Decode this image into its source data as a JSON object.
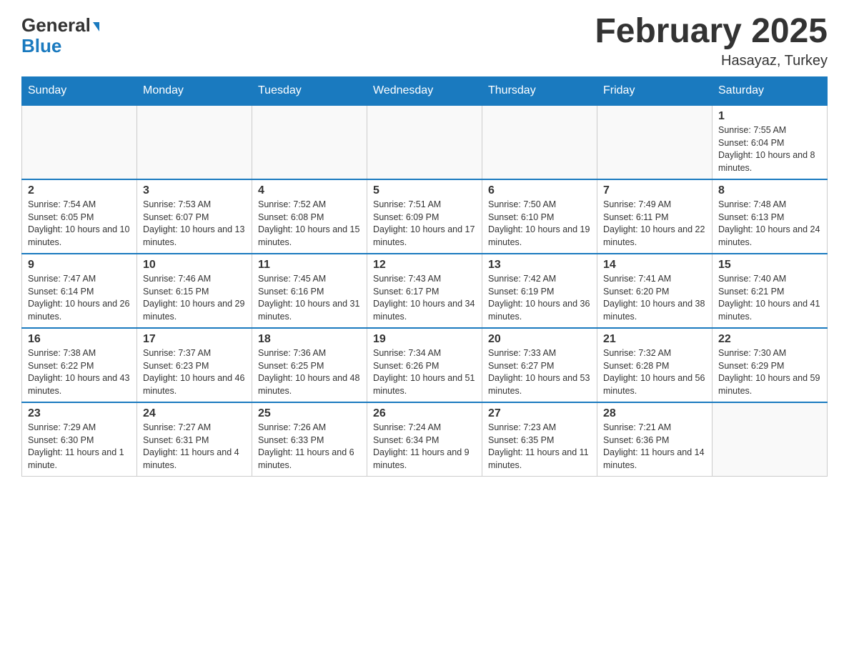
{
  "header": {
    "logo_general": "General",
    "logo_blue": "Blue",
    "month_title": "February 2025",
    "location": "Hasayaz, Turkey"
  },
  "days_of_week": [
    "Sunday",
    "Monday",
    "Tuesday",
    "Wednesday",
    "Thursday",
    "Friday",
    "Saturday"
  ],
  "weeks": [
    {
      "cells": [
        {
          "day": "",
          "empty": true
        },
        {
          "day": "",
          "empty": true
        },
        {
          "day": "",
          "empty": true
        },
        {
          "day": "",
          "empty": true
        },
        {
          "day": "",
          "empty": true
        },
        {
          "day": "",
          "empty": true
        },
        {
          "day": "1",
          "sunrise": "7:55 AM",
          "sunset": "6:04 PM",
          "daylight": "10 hours and 8 minutes."
        }
      ]
    },
    {
      "cells": [
        {
          "day": "2",
          "sunrise": "7:54 AM",
          "sunset": "6:05 PM",
          "daylight": "10 hours and 10 minutes."
        },
        {
          "day": "3",
          "sunrise": "7:53 AM",
          "sunset": "6:07 PM",
          "daylight": "10 hours and 13 minutes."
        },
        {
          "day": "4",
          "sunrise": "7:52 AM",
          "sunset": "6:08 PM",
          "daylight": "10 hours and 15 minutes."
        },
        {
          "day": "5",
          "sunrise": "7:51 AM",
          "sunset": "6:09 PM",
          "daylight": "10 hours and 17 minutes."
        },
        {
          "day": "6",
          "sunrise": "7:50 AM",
          "sunset": "6:10 PM",
          "daylight": "10 hours and 19 minutes."
        },
        {
          "day": "7",
          "sunrise": "7:49 AM",
          "sunset": "6:11 PM",
          "daylight": "10 hours and 22 minutes."
        },
        {
          "day": "8",
          "sunrise": "7:48 AM",
          "sunset": "6:13 PM",
          "daylight": "10 hours and 24 minutes."
        }
      ]
    },
    {
      "cells": [
        {
          "day": "9",
          "sunrise": "7:47 AM",
          "sunset": "6:14 PM",
          "daylight": "10 hours and 26 minutes."
        },
        {
          "day": "10",
          "sunrise": "7:46 AM",
          "sunset": "6:15 PM",
          "daylight": "10 hours and 29 minutes."
        },
        {
          "day": "11",
          "sunrise": "7:45 AM",
          "sunset": "6:16 PM",
          "daylight": "10 hours and 31 minutes."
        },
        {
          "day": "12",
          "sunrise": "7:43 AM",
          "sunset": "6:17 PM",
          "daylight": "10 hours and 34 minutes."
        },
        {
          "day": "13",
          "sunrise": "7:42 AM",
          "sunset": "6:19 PM",
          "daylight": "10 hours and 36 minutes."
        },
        {
          "day": "14",
          "sunrise": "7:41 AM",
          "sunset": "6:20 PM",
          "daylight": "10 hours and 38 minutes."
        },
        {
          "day": "15",
          "sunrise": "7:40 AM",
          "sunset": "6:21 PM",
          "daylight": "10 hours and 41 minutes."
        }
      ]
    },
    {
      "cells": [
        {
          "day": "16",
          "sunrise": "7:38 AM",
          "sunset": "6:22 PM",
          "daylight": "10 hours and 43 minutes."
        },
        {
          "day": "17",
          "sunrise": "7:37 AM",
          "sunset": "6:23 PM",
          "daylight": "10 hours and 46 minutes."
        },
        {
          "day": "18",
          "sunrise": "7:36 AM",
          "sunset": "6:25 PM",
          "daylight": "10 hours and 48 minutes."
        },
        {
          "day": "19",
          "sunrise": "7:34 AM",
          "sunset": "6:26 PM",
          "daylight": "10 hours and 51 minutes."
        },
        {
          "day": "20",
          "sunrise": "7:33 AM",
          "sunset": "6:27 PM",
          "daylight": "10 hours and 53 minutes."
        },
        {
          "day": "21",
          "sunrise": "7:32 AM",
          "sunset": "6:28 PM",
          "daylight": "10 hours and 56 minutes."
        },
        {
          "day": "22",
          "sunrise": "7:30 AM",
          "sunset": "6:29 PM",
          "daylight": "10 hours and 59 minutes."
        }
      ]
    },
    {
      "cells": [
        {
          "day": "23",
          "sunrise": "7:29 AM",
          "sunset": "6:30 PM",
          "daylight": "11 hours and 1 minute."
        },
        {
          "day": "24",
          "sunrise": "7:27 AM",
          "sunset": "6:31 PM",
          "daylight": "11 hours and 4 minutes."
        },
        {
          "day": "25",
          "sunrise": "7:26 AM",
          "sunset": "6:33 PM",
          "daylight": "11 hours and 6 minutes."
        },
        {
          "day": "26",
          "sunrise": "7:24 AM",
          "sunset": "6:34 PM",
          "daylight": "11 hours and 9 minutes."
        },
        {
          "day": "27",
          "sunrise": "7:23 AM",
          "sunset": "6:35 PM",
          "daylight": "11 hours and 11 minutes."
        },
        {
          "day": "28",
          "sunrise": "7:21 AM",
          "sunset": "6:36 PM",
          "daylight": "11 hours and 14 minutes."
        },
        {
          "day": "",
          "empty": true
        }
      ]
    }
  ]
}
